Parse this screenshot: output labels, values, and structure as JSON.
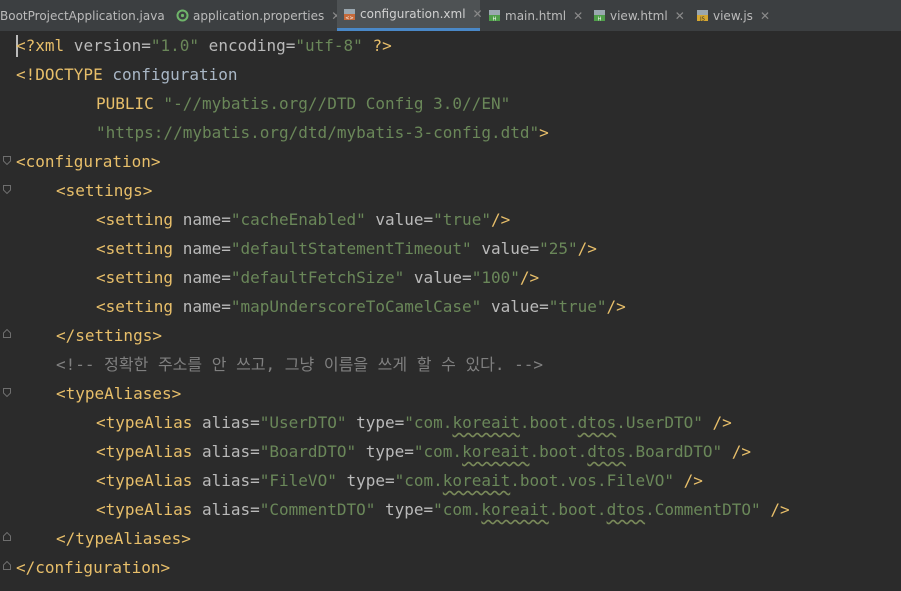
{
  "tabs": [
    {
      "label": "BootProjectApplication.java",
      "icon": "java-class-icon",
      "active": false,
      "closable": false
    },
    {
      "label": "application.properties",
      "icon": "spring-properties-icon",
      "active": false,
      "closable": true
    },
    {
      "label": "configuration.xml",
      "icon": "xml-file-icon",
      "active": true,
      "closable": true
    },
    {
      "label": "main.html",
      "icon": "html-file-icon",
      "active": false,
      "closable": true
    },
    {
      "label": "view.html",
      "icon": "html-file-icon",
      "active": false,
      "closable": true
    },
    {
      "label": "view.js",
      "icon": "js-file-icon",
      "active": false,
      "closable": true
    }
  ],
  "close_glyph": "✕",
  "colors": {
    "background": "#2b2b2b",
    "tag": "#e8bf6a",
    "string": "#6a8759",
    "comment": "#808080",
    "text": "#a9b7c6"
  },
  "code": {
    "l1": {
      "a": "<?xml",
      "b": " version=",
      "c": "\"1.0\"",
      "d": " encoding=",
      "e": "\"utf-8\"",
      "f": " ?>"
    },
    "l2": {
      "a": "<!DOCTYPE",
      "b": " configuration"
    },
    "l3": {
      "a": "PUBLIC",
      "b": " \"-//mybatis.org//DTD Config 3.0//EN\""
    },
    "l4": {
      "a": "\"https://mybatis.org/dtd/mybatis-3-config.dtd\"",
      "b": ">"
    },
    "l5": {
      "a": "<configuration>"
    },
    "l6": {
      "a": "<settings>"
    },
    "l7": {
      "a": "<setting",
      "b": " name=",
      "c": "\"cacheEnabled\"",
      "d": " value=",
      "e": "\"true\"",
      "f": "/>"
    },
    "l8": {
      "a": "<setting",
      "b": " name=",
      "c": "\"defaultStatementTimeout\"",
      "d": " value=",
      "e": "\"25\"",
      "f": "/>"
    },
    "l9": {
      "a": "<setting",
      "b": " name=",
      "c": "\"defaultFetchSize\"",
      "d": " value=",
      "e": "\"100\"",
      "f": "/>"
    },
    "l10": {
      "a": "<setting",
      "b": " name=",
      "c": "\"mapUnderscoreToCamelCase\"",
      "d": " value=",
      "e": "\"true\"",
      "f": "/>"
    },
    "l11": {
      "a": "</settings>"
    },
    "l12": {
      "a": "<!-- 정확한 주소를 안 쓰고, 그냥 이름을 쓰게 할 수 있다. -->"
    },
    "l13": {
      "a": "<typeAliases>"
    },
    "l14": {
      "a": "<typeAlias",
      "b": " alias=",
      "c": "\"UserDTO\"",
      "d": " type=",
      "e1": "\"com.",
      "e2": "koreait",
      "e3": ".boot.",
      "e4": "dtos",
      "e5": ".UserDTO\"",
      "f": " />"
    },
    "l15": {
      "a": "<typeAlias",
      "b": " alias=",
      "c": "\"BoardDTO\"",
      "d": " type=",
      "e1": "\"com.",
      "e2": "koreait",
      "e3": ".boot.",
      "e4": "dtos",
      "e5": ".BoardDTO\"",
      "f": " />"
    },
    "l16": {
      "a": "<typeAlias",
      "b": " alias=",
      "c": "\"FileVO\"",
      "d": " type=",
      "e1": "\"com.",
      "e2": "koreait",
      "e3": ".boot.",
      "e4": "vos",
      "e5": ".FileVO\"",
      "f": " />"
    },
    "l17": {
      "a": "<typeAlias",
      "b": " alias=",
      "c": "\"CommentDTO\"",
      "d": " type=",
      "e1": "\"com.",
      "e2": "koreait",
      "e3": ".boot.",
      "e4": "dtos",
      "e5": ".CommentDTO\"",
      "f": " />"
    },
    "l18": {
      "a": "</typeAliases>"
    },
    "l19": {
      "a": "</configuration>"
    }
  }
}
